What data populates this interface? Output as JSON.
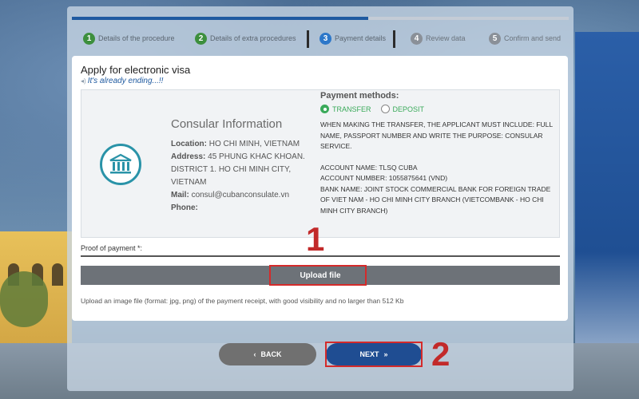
{
  "steps": [
    {
      "num": "1",
      "label": "Details of the procedure"
    },
    {
      "num": "2",
      "label": "Details of extra procedures"
    },
    {
      "num": "3",
      "label": "Payment details"
    },
    {
      "num": "4",
      "label": "Review data"
    },
    {
      "num": "5",
      "label": "Confirm and send"
    }
  ],
  "progress": 0.6,
  "card": {
    "title": "Apply for electronic visa",
    "subtitle": "It's already ending...!!"
  },
  "consular": {
    "title": "Consular Information",
    "location_label": "Location:",
    "location": "HO CHI MINH, VIETNAM",
    "address_label": "Address:",
    "address": "45 PHUNG KHAC KHOAN. DISTRICT 1. HO CHI MINH CITY, VIETNAM",
    "mail_label": "Mail:",
    "mail": "consul@cubanconsulate.vn",
    "phone_label": "Phone:"
  },
  "payment": {
    "title": "Payment methods:",
    "option_transfer": "TRANSFER",
    "option_deposit": "DEPOSIT",
    "selected": "TRANSFER",
    "instructions": "WHEN MAKING THE TRANSFER, THE APPLICANT MUST INCLUDE: FULL NAME, PASSPORT NUMBER AND WRITE THE PURPOSE: CONSULAR SERVICE.",
    "account_name": "ACCOUNT NAME: TLSQ CUBA",
    "account_number": "ACCOUNT NUMBER: 1055875641 (VND)",
    "bank_name": "BANK NAME: JOINT STOCK COMMERCIAL BANK FOR FOREIGN TRADE OF VIET NAM - HO CHI MINH CITY BRANCH (VIETCOMBANK - HO CHI MINH CITY BRANCH)"
  },
  "proof": {
    "label": "Proof of payment *:",
    "upload_label": "Upload file",
    "hint": "Upload an image file (format: jpg, png) of the payment receipt, with good visibility and no larger than 512 Kb"
  },
  "nav": {
    "back": "BACK",
    "next": "NEXT"
  },
  "annotations": {
    "one": "1",
    "two": "2",
    "color": "#d42a2a"
  },
  "colors": {
    "primary": "#1f4d92",
    "success": "#3aaa5a",
    "icon": "#2a93a8"
  }
}
